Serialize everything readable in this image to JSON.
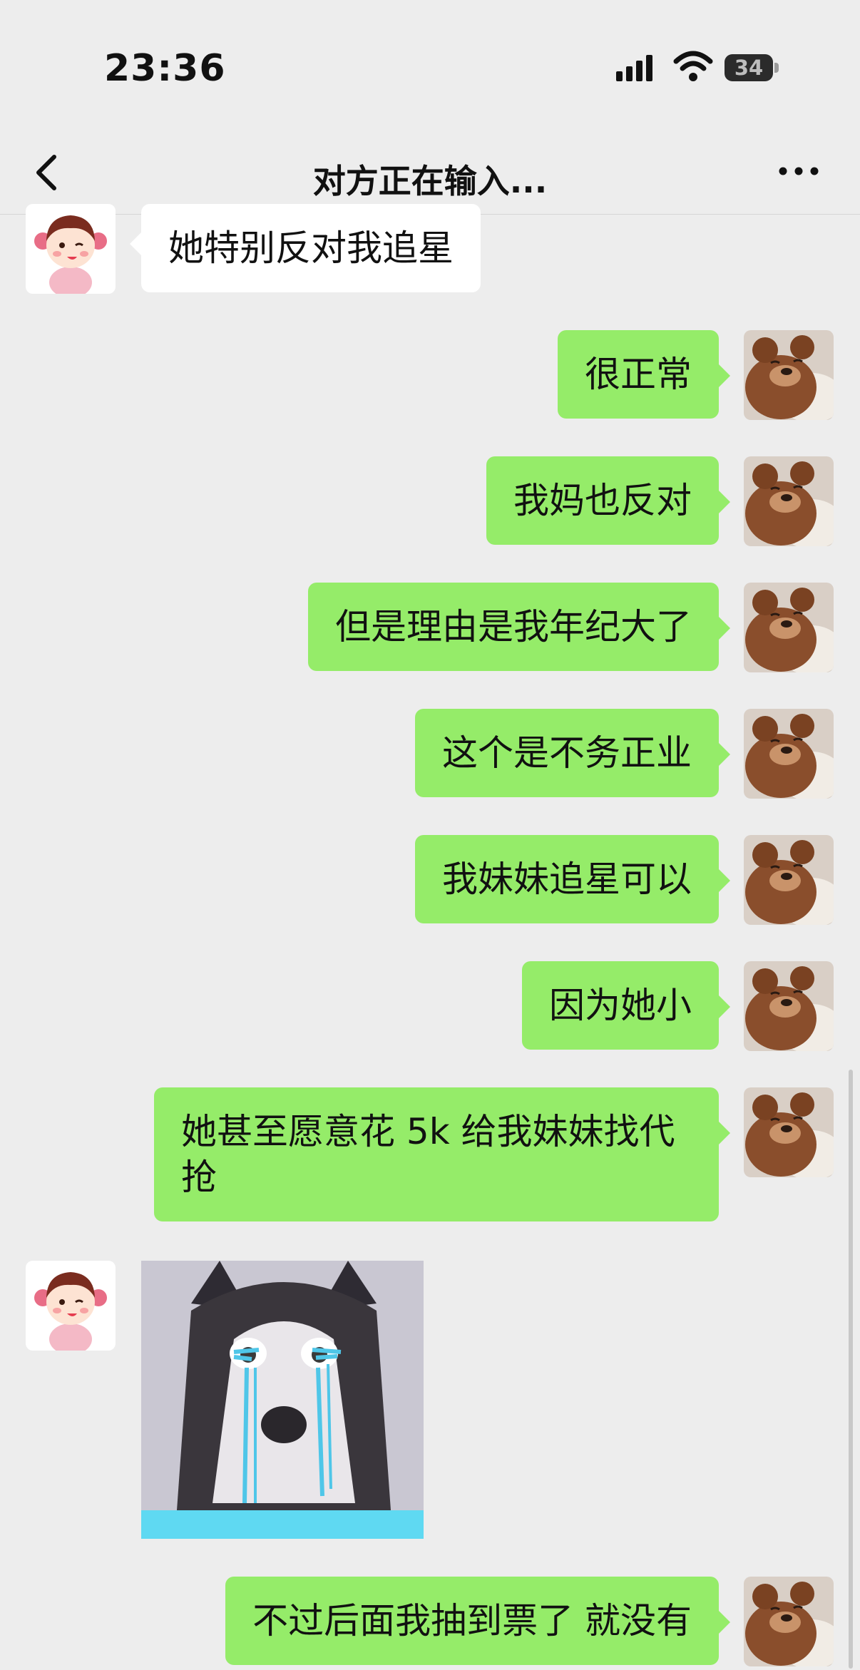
{
  "status_bar": {
    "time": "23:36",
    "battery": "34"
  },
  "header": {
    "title": "对方正在输入..."
  },
  "messages": [
    {
      "side": "in",
      "text": "她特别反对我追星"
    },
    {
      "side": "out",
      "text": "很正常"
    },
    {
      "side": "out",
      "text": "我妈也反对"
    },
    {
      "side": "out",
      "text": "但是理由是我年纪大了"
    },
    {
      "side": "out",
      "text": "这个是不务正业"
    },
    {
      "side": "out",
      "text": "我妹妹追星可以"
    },
    {
      "side": "out",
      "text": "因为她小"
    },
    {
      "side": "out",
      "text": "她甚至愿意花 5k 给我妹妹找代抢"
    },
    {
      "side": "in",
      "type": "image",
      "image": "crying-husky-sticker"
    },
    {
      "side": "out",
      "text": "不过后面我抽到票了 就没有"
    }
  ],
  "avatars": {
    "contact": "girl-avatar",
    "self": "teddy-bear-avatar"
  },
  "colors": {
    "background": "#ededed",
    "out_bubble": "#95ec69",
    "in_bubble": "#ffffff"
  }
}
